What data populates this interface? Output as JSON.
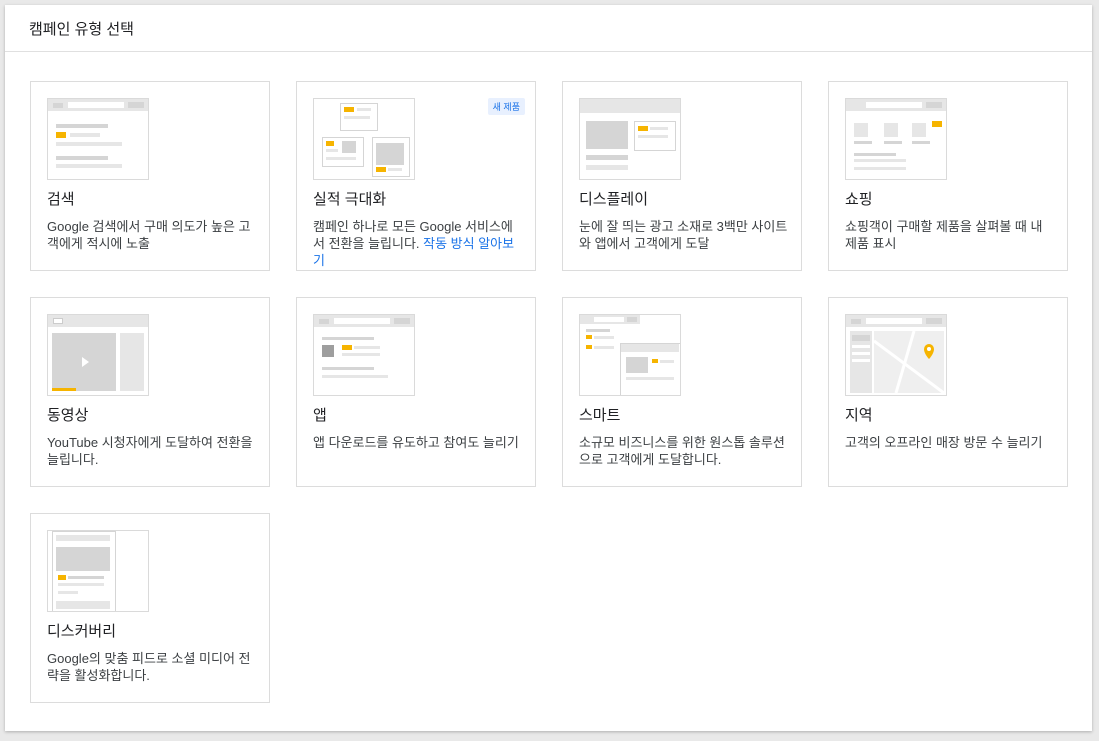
{
  "header": {
    "title": "캠페인 유형 선택"
  },
  "cards": [
    {
      "title": "검색",
      "desc": "Google 검색에서 구매 의도가 높은 고객에게 적시에 노출",
      "icon": "search-thumbnail-icon"
    },
    {
      "title": "실적 극대화",
      "desc": "캠페인 하나로 모든 Google 서비스에서 전환을 늘립니다. ",
      "link": "작동 방식 알아보기",
      "badge": "새 제품",
      "icon": "performance-max-thumbnail-icon"
    },
    {
      "title": "디스플레이",
      "desc": "눈에 잘 띄는 광고 소재로 3백만 사이트와 앱에서 고객에게 도달",
      "icon": "display-thumbnail-icon"
    },
    {
      "title": "쇼핑",
      "desc": "쇼핑객이 구매할 제품을 살펴볼 때 내 제품 표시",
      "icon": "shopping-thumbnail-icon"
    },
    {
      "title": "동영상",
      "desc": "YouTube 시청자에게 도달하여 전환을 늘립니다.",
      "icon": "video-thumbnail-icon"
    },
    {
      "title": "앱",
      "desc": "앱 다운로드를 유도하고 참여도 늘리기",
      "icon": "app-thumbnail-icon"
    },
    {
      "title": "스마트",
      "desc": "소규모 비즈니스를 위한 원스톱 솔루션으로 고객에게 도달합니다.",
      "icon": "smart-thumbnail-icon"
    },
    {
      "title": "지역",
      "desc": "고객의 오프라인 매장 방문 수 늘리기",
      "icon": "local-thumbnail-icon"
    },
    {
      "title": "디스커버리",
      "desc": "Google의 맞춤 피드로 소셜 미디어 전략을 활성화합니다.",
      "icon": "discovery-thumbnail-icon"
    }
  ]
}
